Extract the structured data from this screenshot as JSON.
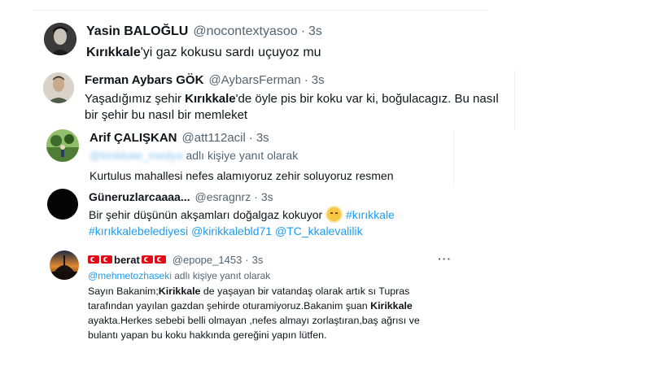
{
  "tweets": [
    {
      "name": "Yasin BALOĞLU",
      "handle": "@nocontextyasoo",
      "sep": "·",
      "time": "3s",
      "text_bold": "Kırıkkale",
      "text_rest": "'yi gaz kokusu sardı uçuyoz mu"
    },
    {
      "name": "Ferman Aybars GÖK",
      "handle": "@AybarsFerman",
      "sep": "·",
      "time": "3s",
      "text_before": "Yaşadığımız şehir ",
      "text_bold": "Kırıkkale",
      "text_after": "'de öyle pis bir koku var ki, boğulacagız. Bu nasıl",
      "text_line2": "bir şehir bu nasıl bir memleket"
    },
    {
      "name": "Arif ÇALIŞKAN",
      "handle": "@att112acil",
      "sep": "·",
      "time": "3s",
      "reply_mention": "@kirikkale_medya",
      "reply_suffix": " adlı kişiye yanıt olarak",
      "text": "Kurtulus mahallesi  nefes alamıyoruz zehir soluyoruz resmen"
    },
    {
      "name": "Güneruzlarcaaaa...",
      "handle": "@esragnrz",
      "sep": "·",
      "time": "3s",
      "text_before": "Bir şehir düşünün akşamları doğalgaz kokuyor ",
      "tag1": "#kırıkkale",
      "tag2": "#kırıkkalebelediyesi",
      "tag3": "@kirikkalebld71",
      "tag4": "@TC_kkalevalilik"
    },
    {
      "name": "berat",
      "handle": "@epope_1453",
      "sep": "·",
      "time": "3s",
      "more": "···",
      "reply_mention": "@mehmetozhaseki",
      "reply_suffix": " adlı kişiye yanıt olarak",
      "l1_before": "Sayın Bakanim;",
      "l1_bold": "Kirikkale",
      "l1_after": " de yaşayan bir vatandaş olarak artık sı Tupras",
      "l2": "tarafından yayılan gazdan  şehirde oturamiyoruz.Bakanim şuan ",
      "l2_bold": "Kirikkale",
      "l3": "ayakta.Herkes sebebi belli olmayan ,nefes almayı zorlaştıran,baş ağrısı ve",
      "l4": "bulantı yapan bu koku hakkında gereğini yapın lütfen."
    }
  ],
  "colors": {
    "link": "#1d9bf0",
    "secondary": "#536471",
    "text": "#0f1419"
  }
}
